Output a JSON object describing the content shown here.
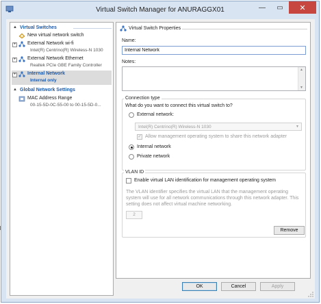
{
  "window": {
    "title": "Virtual Switch Manager for ANURAGGX01",
    "min_glyph": "—",
    "max_glyph": "▭",
    "close_glyph": "✕"
  },
  "tree": {
    "virtual_switches_header": "Virtual Switches",
    "new_switch": {
      "label": "New virtual network switch"
    },
    "items": [
      {
        "label": "External Network wi-fi",
        "sub": "Intel(R) Centrino(R) Wireless-N 1030"
      },
      {
        "label": "External Network Ethernet",
        "sub": "Realtek PCIe GBE Family Controller"
      },
      {
        "label": "Internal Network",
        "sub": "Internal only"
      }
    ],
    "global_header": "Global Network Settings",
    "mac": {
      "label": "MAC Address Range",
      "sub": "00-15-5D-0C-55-00 to 00-15-5D-0..."
    }
  },
  "props": {
    "title": "Virtual Switch Properties",
    "name_label": "Name:",
    "name_value": "Internal Network",
    "notes_label": "Notes:",
    "connection": {
      "title": "Connection type",
      "question": "What do you want to connect this virtual switch to?",
      "external_label": "External network:",
      "adapter_value": "Intel(R) Centrino(R) Wireless-N 1030",
      "allow_mgmt_label": "Allow management operating system to share this network adapter",
      "internal_label": "Internal network",
      "private_label": "Private network"
    },
    "vlan": {
      "title": "VLAN ID",
      "enable_label": "Enable virtual LAN identification for management operating system",
      "description": "The VLAN identifier specifies the virtual LAN that the management operating system will use for all network communications through this network adapter. This setting does not affect virtual machine networking.",
      "id_value": "2"
    },
    "remove_label": "Remove"
  },
  "buttons": {
    "ok": "OK",
    "cancel": "Cancel",
    "apply": "Apply"
  },
  "colors": {
    "accent": "#1e5aa8",
    "close": "#c7463f",
    "frame": "#d8e4f2"
  }
}
